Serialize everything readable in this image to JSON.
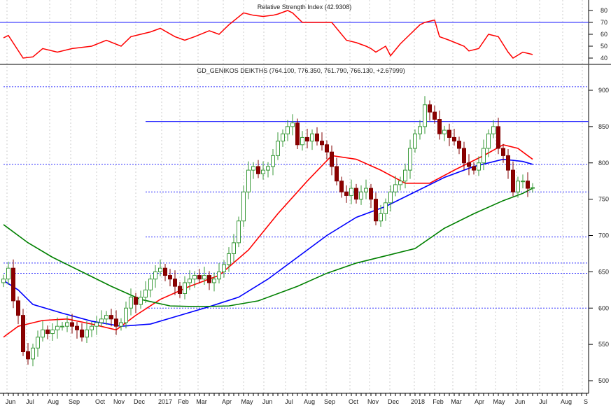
{
  "chart_data": [
    {
      "type": "line",
      "title": "Relative Strength Index (42.9308)",
      "yticks": [
        80,
        70,
        60,
        50,
        40
      ],
      "ylim": [
        30,
        90
      ],
      "reference_line": 70,
      "series": [
        {
          "name": "RSI",
          "color": "#ff0000",
          "points": [
            [
              0,
              57
            ],
            [
              1,
              59
            ],
            [
              4,
              40
            ],
            [
              6,
              41
            ],
            [
              8,
              48
            ],
            [
              11,
              45
            ],
            [
              14,
              48
            ],
            [
              18,
              50
            ],
            [
              21,
              55
            ],
            [
              24,
              50
            ],
            [
              26,
              58
            ],
            [
              28,
              60
            ],
            [
              30,
              62
            ],
            [
              32,
              65
            ],
            [
              35,
              58
            ],
            [
              37,
              55
            ],
            [
              39,
              58
            ],
            [
              42,
              63
            ],
            [
              44,
              60
            ],
            [
              46,
              68
            ],
            [
              49,
              78
            ],
            [
              51,
              76
            ],
            [
              53,
              75
            ],
            [
              55,
              76
            ],
            [
              56,
              77
            ],
            [
              58,
              80
            ],
            [
              59,
              78
            ],
            [
              61,
              70
            ],
            [
              63,
              70
            ],
            [
              65,
              70
            ],
            [
              67,
              70
            ],
            [
              70,
              55
            ],
            [
              72,
              53
            ],
            [
              74,
              50
            ],
            [
              75,
              48
            ],
            [
              76,
              45
            ],
            [
              78,
              50
            ],
            [
              79,
              42
            ],
            [
              81,
              52
            ],
            [
              83,
              60
            ],
            [
              85,
              68
            ],
            [
              86,
              70
            ],
            [
              88,
              72
            ],
            [
              89,
              58
            ],
            [
              91,
              55
            ],
            [
              94,
              50
            ],
            [
              95,
              46
            ],
            [
              97,
              48
            ],
            [
              99,
              60
            ],
            [
              101,
              58
            ],
            [
              103,
              45
            ],
            [
              104,
              40
            ],
            [
              106,
              45
            ],
            [
              108,
              43
            ]
          ]
        }
      ]
    },
    {
      "type": "candlestick",
      "title": "GD_GENIKOS DEIKTHS (764.100, 776.350, 761.790, 766.130, +2.67999)",
      "yticks": [
        900,
        850,
        800,
        750,
        700,
        650,
        600,
        550,
        500
      ],
      "ylim": [
        490,
        920
      ],
      "xticks": [
        "Jun",
        "Jul",
        "Aug",
        "Sep",
        "Oct",
        "Nov",
        "Dec",
        "2017",
        "Feb",
        "Mar",
        "Apr",
        "May",
        "Jun",
        "Jul",
        "Aug",
        "Sep",
        "Oct",
        "Nov",
        "Dec",
        "2018",
        "Feb",
        "Mar",
        "Apr",
        "May",
        "Jun",
        "Jul",
        "Aug",
        "S"
      ],
      "closes": [
        640,
        655,
        610,
        590,
        540,
        530,
        545,
        560,
        570,
        565,
        570,
        575,
        575,
        580,
        575,
        570,
        560,
        570,
        575,
        580,
        585,
        590,
        585,
        575,
        580,
        600,
        615,
        605,
        615,
        625,
        640,
        650,
        655,
        645,
        640,
        630,
        620,
        635,
        640,
        645,
        640,
        645,
        635,
        640,
        650,
        660,
        675,
        690,
        720,
        760,
        790,
        795,
        785,
        790,
        795,
        810,
        830,
        840,
        850,
        855,
        825,
        835,
        830,
        840,
        830,
        825,
        815,
        795,
        775,
        760,
        755,
        765,
        750,
        760,
        765,
        750,
        720,
        730,
        745,
        760,
        770,
        775,
        790,
        820,
        840,
        850,
        880,
        870,
        860,
        840,
        845,
        835,
        830,
        820,
        800,
        795,
        790,
        800,
        820,
        840,
        850,
        820,
        810,
        790,
        760,
        775,
        775,
        765,
        766
      ],
      "moving_averages": [
        {
          "name": "MA-red",
          "color": "#ff0000",
          "points": [
            [
              0,
              560
            ],
            [
              3,
              575
            ],
            [
              8,
              583
            ],
            [
              13,
              585
            ],
            [
              18,
              578
            ],
            [
              23,
              570
            ],
            [
              27,
              590
            ],
            [
              32,
              612
            ],
            [
              38,
              630
            ],
            [
              44,
              645
            ],
            [
              50,
              680
            ],
            [
              56,
              730
            ],
            [
              62,
              775
            ],
            [
              67,
              810
            ],
            [
              72,
              805
            ],
            [
              77,
              790
            ],
            [
              82,
              772
            ],
            [
              87,
              772
            ],
            [
              92,
              790
            ],
            [
              98,
              810
            ],
            [
              102,
              825
            ],
            [
              105,
              820
            ],
            [
              108,
              805
            ]
          ]
        },
        {
          "name": "MA-blue",
          "color": "#0000ff",
          "points": [
            [
              0,
              638
            ],
            [
              3,
              625
            ],
            [
              6,
              605
            ],
            [
              12,
              593
            ],
            [
              18,
              582
            ],
            [
              24,
              575
            ],
            [
              30,
              578
            ],
            [
              36,
              590
            ],
            [
              42,
              602
            ],
            [
              48,
              615
            ],
            [
              54,
              640
            ],
            [
              60,
              670
            ],
            [
              66,
              700
            ],
            [
              72,
              725
            ],
            [
              78,
              740
            ],
            [
              84,
              760
            ],
            [
              90,
              780
            ],
            [
              96,
              795
            ],
            [
              102,
              805
            ],
            [
              106,
              802
            ],
            [
              108,
              798
            ]
          ]
        },
        {
          "name": "MA-green",
          "color": "#008000",
          "points": [
            [
              0,
              715
            ],
            [
              5,
              690
            ],
            [
              10,
              670
            ],
            [
              16,
              650
            ],
            [
              22,
              630
            ],
            [
              28,
              612
            ],
            [
              34,
              603
            ],
            [
              40,
              602
            ],
            [
              46,
              603
            ],
            [
              52,
              610
            ],
            [
              60,
              630
            ],
            [
              66,
              648
            ],
            [
              72,
              662
            ],
            [
              78,
              672
            ],
            [
              84,
              682
            ],
            [
              90,
              710
            ],
            [
              96,
              730
            ],
            [
              102,
              748
            ],
            [
              106,
              758
            ],
            [
              108,
              765
            ]
          ]
        }
      ],
      "hlines": [
        {
          "value": 905,
          "style": "dotted",
          "from_week": 0
        },
        {
          "value": 857,
          "style": "solid",
          "from_week": 29
        },
        {
          "value": 798,
          "style": "dotted",
          "from_week": 0
        },
        {
          "value": 760,
          "style": "dotted",
          "from_week": 29
        },
        {
          "value": 698,
          "style": "dotted",
          "from_week": 29
        },
        {
          "value": 662,
          "style": "dotted",
          "from_week": 0
        },
        {
          "value": 648,
          "style": "dotted",
          "from_week": 0
        },
        {
          "value": 600,
          "style": "dotted",
          "from_week": 29
        }
      ]
    }
  ]
}
